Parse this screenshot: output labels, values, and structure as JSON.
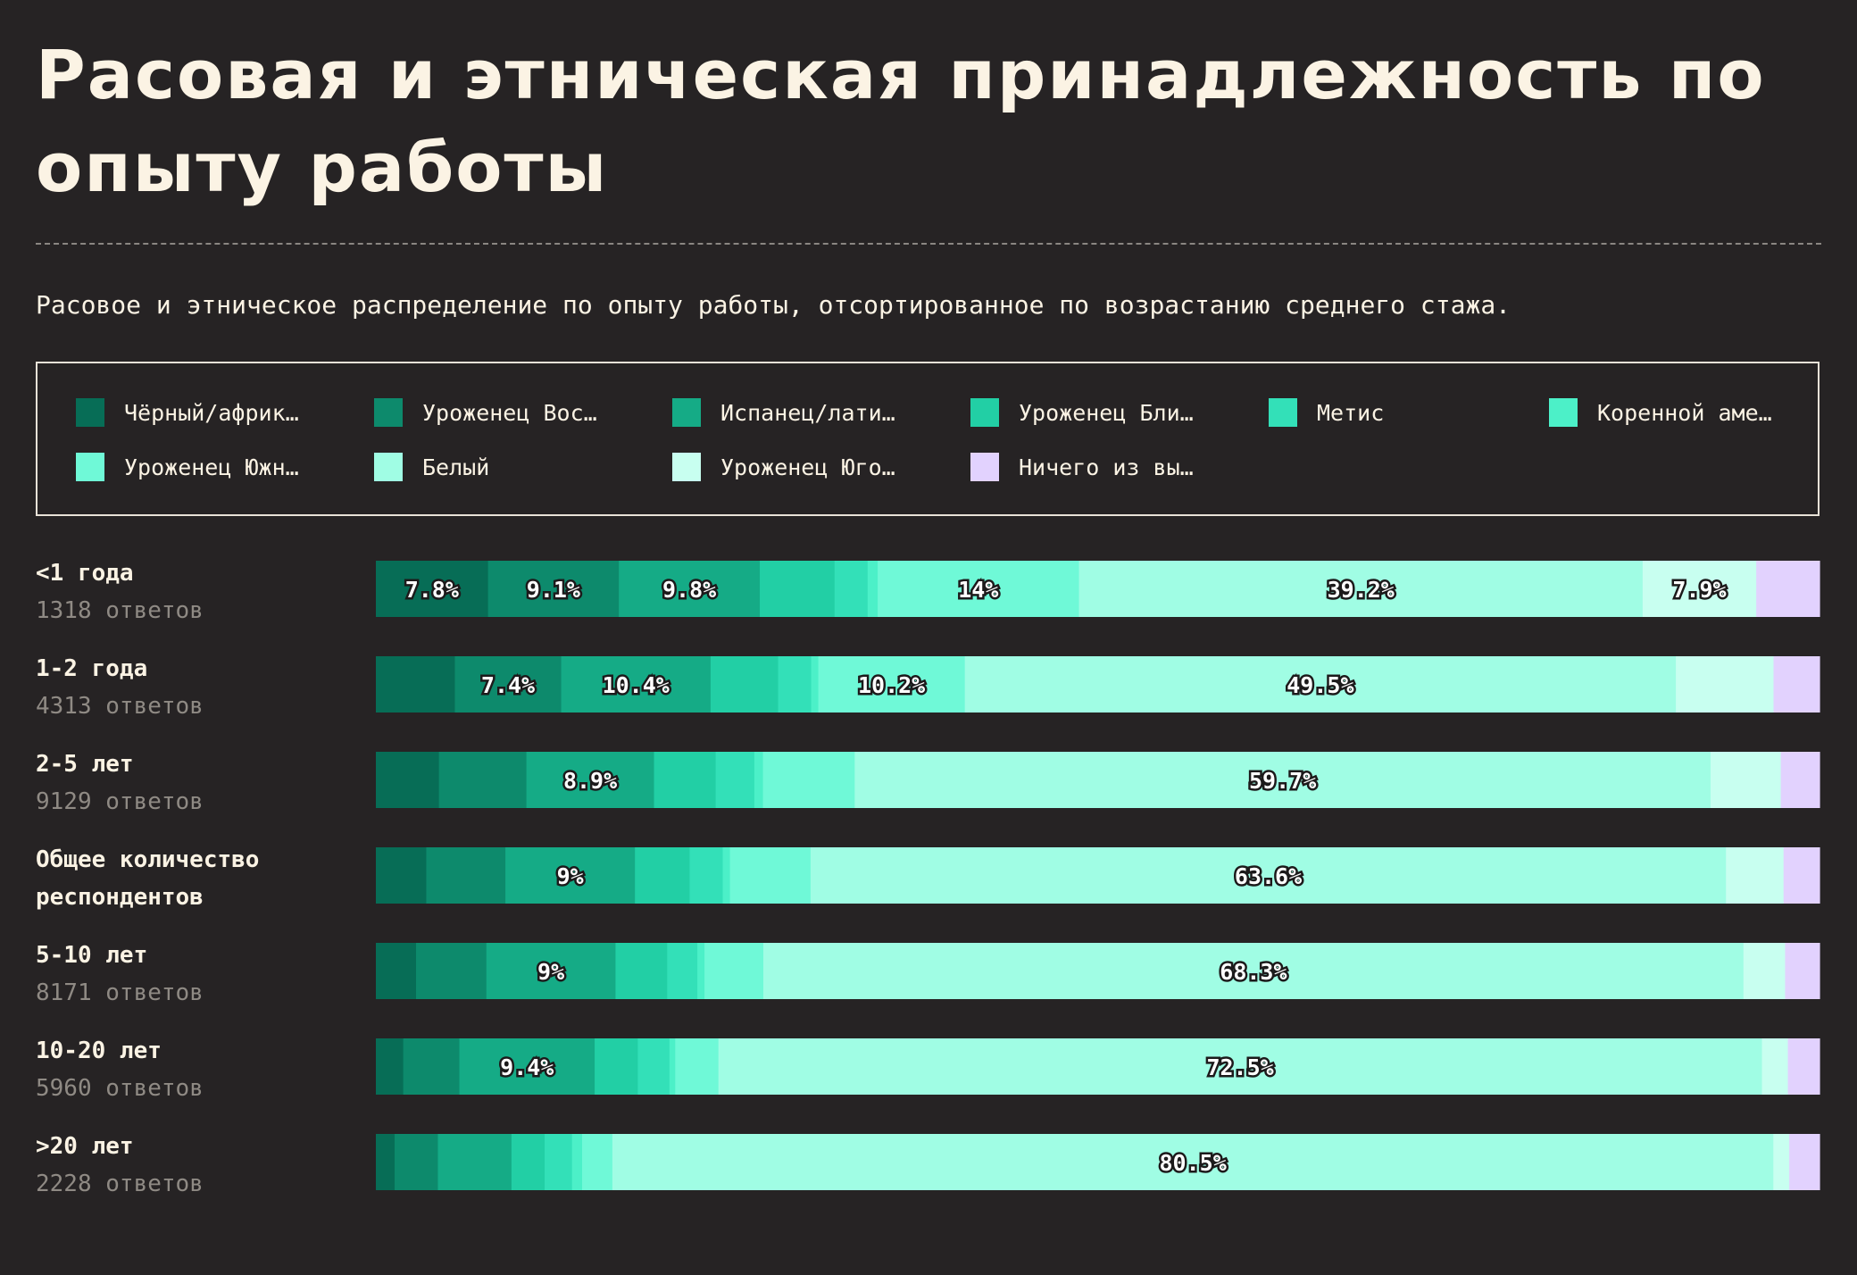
{
  "title": "Расовая и этническая принадлежность по опыту работы",
  "subtitle": "Расовое и этническое распределение по опыту работы, отсортированное по возрастанию среднего стажа.",
  "chart_data": {
    "type": "bar",
    "orientation": "horizontal",
    "stacked": true,
    "normalized": true,
    "xlim": [
      0,
      100
    ],
    "legend_position": "top",
    "grid": false,
    "legend": [
      {
        "label": "Чёрный/африк…",
        "color": "#076d56"
      },
      {
        "label": "Уроженец Вос…",
        "color": "#0d8a6c"
      },
      {
        "label": "Испанец/лати…",
        "color": "#15ab86"
      },
      {
        "label": "Уроженец Бли…",
        "color": "#22cfa5"
      },
      {
        "label": "Метис",
        "color": "#33e0b8"
      },
      {
        "label": "Коренной аме…",
        "color": "#4cf0c8"
      },
      {
        "label": "Уроженец Южн…",
        "color": "#6ff9d7"
      },
      {
        "label": "Белый",
        "color": "#a0fde4"
      },
      {
        "label": "Уроженец Юго…",
        "color": "#c8fff0"
      },
      {
        "label": "Ничего из вы…",
        "color": "#e2d2fe"
      }
    ],
    "categories": [
      {
        "name": "<1 года",
        "count": "1318 ответов",
        "values": [
          7.8,
          9.1,
          9.8,
          5.2,
          2.3,
          0.7,
          14,
          39.2,
          7.9,
          4.4
        ]
      },
      {
        "name": "1-2 года",
        "count": "4313 ответов",
        "values": [
          5.5,
          7.4,
          10.4,
          4.7,
          2.3,
          0.5,
          10.2,
          49.5,
          6.8,
          3.2
        ]
      },
      {
        "name": "2-5 лет",
        "count": "9129 ответов",
        "values": [
          4.4,
          6.1,
          8.9,
          4.3,
          2.7,
          0.6,
          6.4,
          59.7,
          4.9,
          2.7
        ]
      },
      {
        "name": "Общее количество респондентов",
        "count": "",
        "values": [
          3.5,
          5.5,
          9,
          3.8,
          2.3,
          0.5,
          5.6,
          63.6,
          4,
          2.5
        ]
      },
      {
        "name": "5-10 лет",
        "count": "8171 ответов",
        "values": [
          2.8,
          4.9,
          9,
          3.6,
          2.1,
          0.5,
          4.1,
          68.3,
          2.9,
          2.4
        ]
      },
      {
        "name": "10-20 лет",
        "count": "5960 ответов",
        "values": [
          1.9,
          3.9,
          9.4,
          3,
          2.2,
          0.4,
          3,
          72.5,
          1.8,
          2.2
        ]
      },
      {
        "name": ">20 лет",
        "count": "2228 ответов",
        "values": [
          1.3,
          3,
          5.1,
          2.3,
          1.9,
          0.7,
          2.1,
          80.5,
          1.1,
          2.1
        ]
      }
    ],
    "shown_labels": [
      [
        "7.8%",
        "9.1%",
        "9.8%",
        "",
        "",
        "",
        "14%",
        "39.2%",
        "7.9%",
        ""
      ],
      [
        "",
        "7.4%",
        "10.4%",
        "",
        "",
        "",
        "10.2%",
        "49.5%",
        "",
        ""
      ],
      [
        "",
        "",
        "8.9%",
        "",
        "",
        "",
        "",
        "59.7%",
        "",
        ""
      ],
      [
        "",
        "",
        "9%",
        "",
        "",
        "",
        "",
        "63.6%",
        "",
        ""
      ],
      [
        "",
        "",
        "9%",
        "",
        "",
        "",
        "",
        "68.3%",
        "",
        ""
      ],
      [
        "",
        "",
        "9.4%",
        "",
        "",
        "",
        "",
        "72.5%",
        "",
        ""
      ],
      [
        "",
        "",
        "",
        "",
        "",
        "",
        "",
        "80.5%",
        "",
        ""
      ]
    ]
  }
}
